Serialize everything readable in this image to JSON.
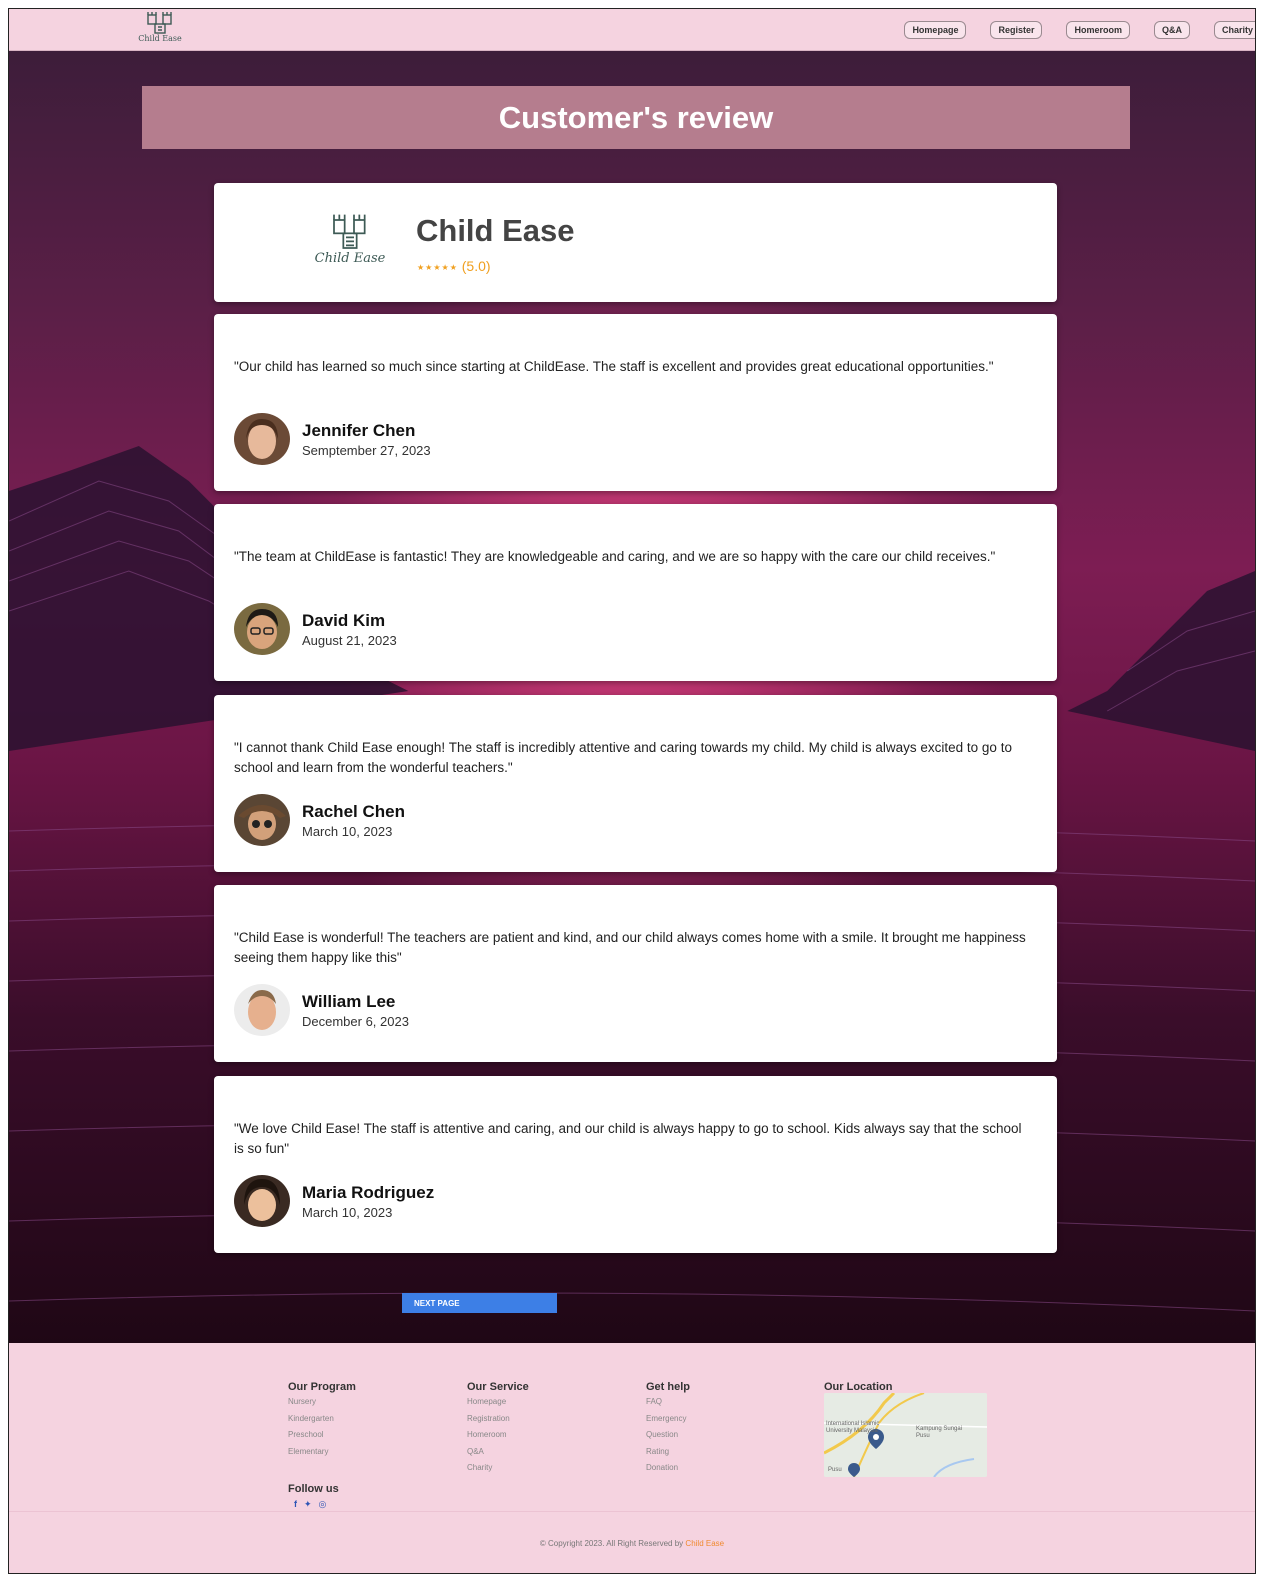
{
  "nav": {
    "logo_label": "Child Ease",
    "links": [
      "Homepage",
      "Register",
      "Homeroom",
      "Q&A",
      "Charity"
    ]
  },
  "page_title": "Customer's review",
  "brand": {
    "logo_label": "Child Ease",
    "name": "Child Ease",
    "stars": "★★★★★",
    "rating": "(5.0)"
  },
  "reviews": [
    {
      "text": "\"Our child has learned so much since starting at ChildEase. The staff is excellent and provides great educational opportunities.\"",
      "name": "Jennifer Chen",
      "date": "Semptember 27, 2023"
    },
    {
      "text": "\"The team at ChildEase is fantastic! They are knowledgeable and caring, and we are so happy with the care our child receives.\"",
      "name": "David Kim",
      "date": "August 21, 2023"
    },
    {
      "text": "\"I cannot thank Child Ease enough! The staff is incredibly attentive and caring towards my child. My child is always excited to go to school and learn from the wonderful teachers.\"",
      "name": "Rachel Chen",
      "date": "March 10, 2023"
    },
    {
      "text": "\"Child Ease is wonderful! The teachers are patient and kind, and our child always comes home with a smile. It brought me happiness seeing them happy like this\"",
      "name": "William Lee",
      "date": "December 6, 2023"
    },
    {
      "text": "\"We love Child Ease! The staff is attentive and caring, and our child is always happy to go to school. Kids always say that the school is so fun\"",
      "name": "Maria Rodriguez",
      "date": "March 10, 2023"
    }
  ],
  "next_button": "NEXT PAGE",
  "footer": {
    "program": {
      "title": "Our Program",
      "items": [
        "Nursery",
        "Kindergarten",
        "Preschool",
        "Elementary"
      ]
    },
    "service": {
      "title": "Our Service",
      "items": [
        "Homepage",
        "Registration",
        "Homeroom",
        "Q&A",
        "Charity"
      ]
    },
    "help": {
      "title": "Get help",
      "items": [
        "FAQ",
        "Emergency",
        "Question",
        "Rating",
        "Donation"
      ]
    },
    "location": {
      "title": "Our Location",
      "map_labels": [
        "International Islamic University Malaysia",
        "Kampung Sungai Pusu",
        "Pusu"
      ]
    },
    "follow_title": "Follow us",
    "social": [
      "f",
      "t",
      "ig"
    ],
    "copyright": "© Copyright 2023. All Right Reserved by",
    "copyright_brand": "Child Ease"
  },
  "colors": {
    "nav_bg": "#f5d3e0",
    "title_bar": "#b57d8e",
    "next_button": "#3d7fe6",
    "star": "#f0a020",
    "link_brand": "#f08a30"
  }
}
